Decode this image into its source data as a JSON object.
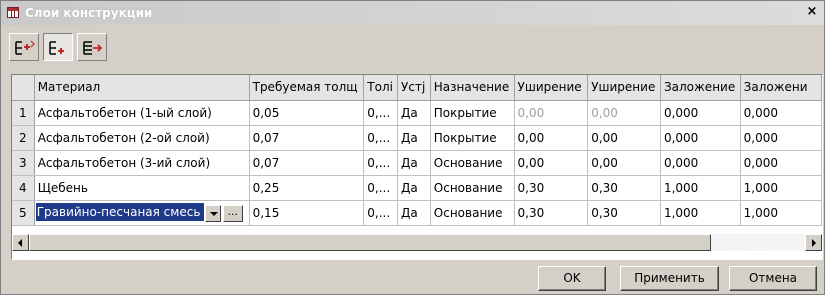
{
  "window": {
    "title": "Слои конструкции",
    "close_label": "×"
  },
  "toolbar": {
    "buttons": [
      {
        "icon": "insert-row-above-icon"
      },
      {
        "icon": "insert-row-below-icon"
      },
      {
        "icon": "append-row-icon"
      }
    ]
  },
  "grid": {
    "columns": [
      "Материал",
      "Требуемая толщ",
      "Толі",
      "Устј",
      "Назначение",
      "Уширение",
      "Уширение",
      "Заложение",
      "Заложени"
    ],
    "rows": [
      {
        "num": "1",
        "cells": [
          "Асфальтобетон (1-ый слой)",
          "0,05",
          "0,...",
          "Да",
          "Покрытие",
          "0,00",
          "0,00",
          "0,000",
          "0,000"
        ]
      },
      {
        "num": "2",
        "cells": [
          "Асфальтобетон (2-ой слой)",
          "0,07",
          "0,...",
          "Да",
          "Покрытие",
          "0,00",
          "0,00",
          "0,000",
          "0,000"
        ]
      },
      {
        "num": "3",
        "cells": [
          "Асфальтобетон (3-ий слой)",
          "0,07",
          "0,...",
          "Да",
          "Основание",
          "0,00",
          "0,00",
          "0,000",
          "0,000"
        ]
      },
      {
        "num": "4",
        "cells": [
          "Щебень",
          "0,25",
          "0,...",
          "Да",
          "Основание",
          "0,30",
          "0,30",
          "1,000",
          "1,000"
        ]
      },
      {
        "num": "5",
        "cells": [
          "Гравийно-песчаная смесь",
          "0,15",
          "0,...",
          "Да",
          "Основание",
          "0,30",
          "0,30",
          "1,000",
          "1,000"
        ]
      }
    ],
    "editor": {
      "ellipsis_label": "..."
    }
  },
  "buttons": {
    "ok": "OK",
    "apply": "Применить",
    "cancel": "Отмена"
  }
}
